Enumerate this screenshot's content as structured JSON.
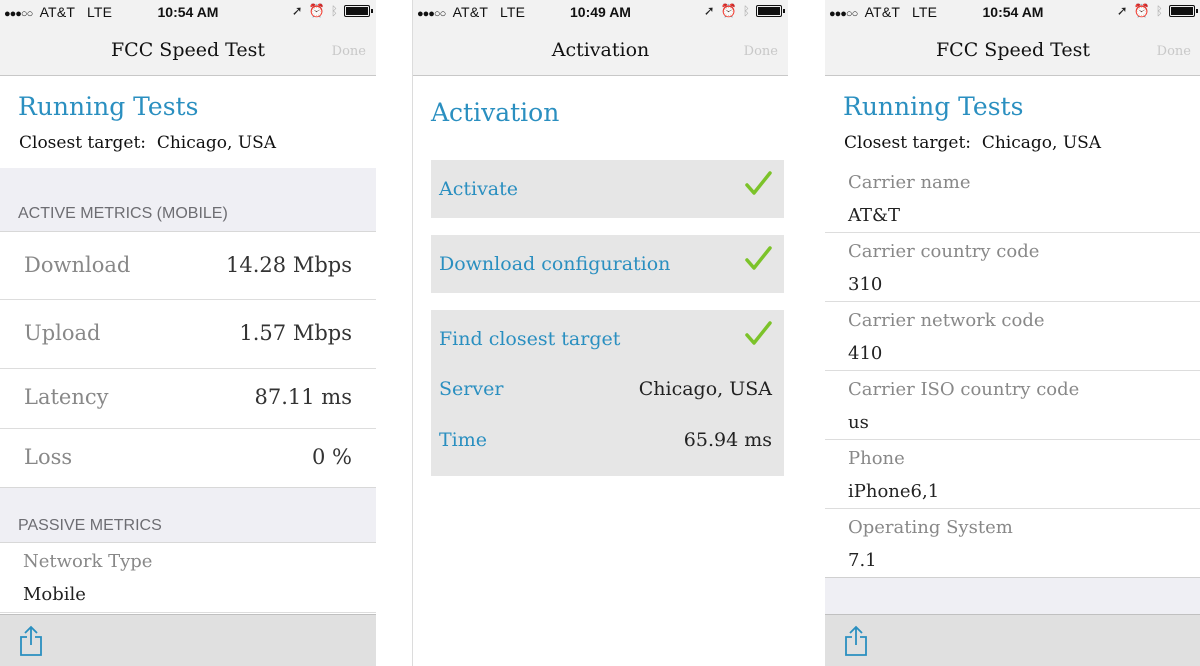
{
  "status": {
    "carrier": "AT&T",
    "network": "LTE",
    "times": [
      "10:54 AM",
      "10:49 AM",
      "10:54 AM"
    ]
  },
  "screen1": {
    "nav_title": "FCC Speed Test",
    "done_label": "Done",
    "heading": "Running Tests",
    "closest_label": "Closest target:",
    "closest_value": "Chicago, USA",
    "active_header": "ACTIVE METRICS (MOBILE)",
    "metrics": [
      {
        "label": "Download",
        "value": "14.28 Mbps"
      },
      {
        "label": "Upload",
        "value": "1.57 Mbps"
      },
      {
        "label": "Latency",
        "value": "87.11 ms"
      },
      {
        "label": "Loss",
        "value": "0 %"
      }
    ],
    "passive_header": "PASSIVE METRICS",
    "passive": [
      {
        "key": "Network Type",
        "value": "Mobile"
      }
    ]
  },
  "screen2": {
    "nav_title": "Activation",
    "done_label": "Done",
    "heading": "Activation",
    "activate": "Activate",
    "download_config": "Download configuration",
    "find_target": "Find closest target",
    "server_label": "Server",
    "server_value": "Chicago, USA",
    "time_label": "Time",
    "time_value": "65.94 ms"
  },
  "screen3": {
    "nav_title": "FCC Speed Test",
    "done_label": "Done",
    "heading": "Running Tests",
    "closest_label": "Closest target:",
    "closest_value": "Chicago, USA",
    "info": [
      {
        "key": "Carrier name",
        "value": "AT&T"
      },
      {
        "key": "Carrier country code",
        "value": "310"
      },
      {
        "key": "Carrier network code",
        "value": "410"
      },
      {
        "key": "Carrier ISO country code",
        "value": "us"
      },
      {
        "key": "Phone",
        "value": "iPhone6,1"
      },
      {
        "key": "Operating System",
        "value": "7.1"
      }
    ]
  },
  "icons": {
    "signal": "signal-dots-icon",
    "location": "location-arrow-icon",
    "alarm": "alarm-clock-icon",
    "bluetooth": "bluetooth-icon",
    "battery": "battery-icon",
    "check": "checkmark-icon",
    "share": "share-icon"
  },
  "colors": {
    "accent_blue": "#2a8fc0",
    "check_green": "#7cc32a",
    "section_bg": "#efeff4",
    "card_bg": "#e6e6e6"
  }
}
